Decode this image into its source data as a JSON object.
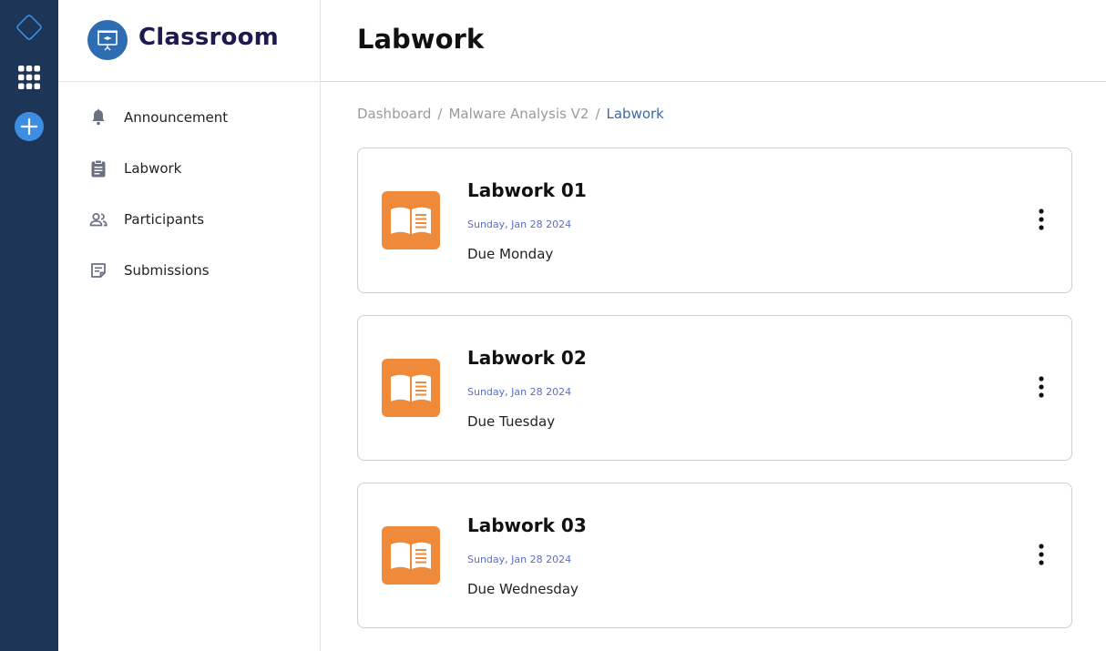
{
  "app": {
    "name": "Classroom"
  },
  "page": {
    "title": "Labwork"
  },
  "breadcrumb": [
    "Dashboard",
    "Malware Analysis V2",
    "Labwork"
  ],
  "sidebar": {
    "items": [
      {
        "label": "Announcement",
        "icon": "bell-icon"
      },
      {
        "label": "Labwork",
        "icon": "clipboard-icon"
      },
      {
        "label": "Participants",
        "icon": "people-icon"
      },
      {
        "label": "Submissions",
        "icon": "notes-icon"
      }
    ]
  },
  "labworks": [
    {
      "title": "Labwork 01",
      "date": "Sunday, Jan 28 2024",
      "due": "Due Monday",
      "icon": "book-icon"
    },
    {
      "title": "Labwork 02",
      "date": "Sunday, Jan 28 2024",
      "due": "Due Tuesday",
      "icon": "book-icon"
    },
    {
      "title": "Labwork 03",
      "date": "Sunday, Jan 28 2024",
      "due": "Due Wednesday",
      "icon": "book-icon"
    }
  ],
  "colors": {
    "rail": "#1d3557",
    "brand_title": "#1b1b4f",
    "accent_blue": "#3d8ee3",
    "card_icon_orange": "#ef8a3a",
    "date_text": "#5a6ec4",
    "breadcrumb_current": "#3b6aa0"
  }
}
